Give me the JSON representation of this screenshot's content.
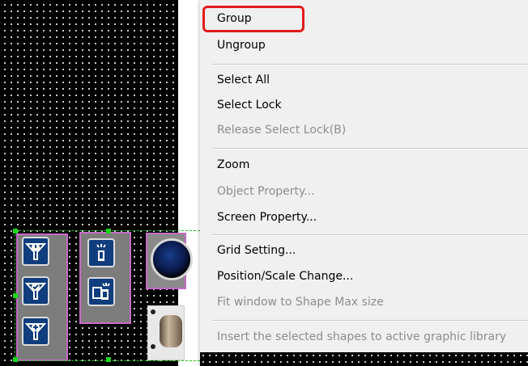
{
  "context_menu": {
    "items": [
      {
        "label": "Group",
        "enabled": true,
        "highlighted": true
      },
      {
        "label": "Ungroup",
        "enabled": true
      },
      {
        "label": "Select All",
        "enabled": true
      },
      {
        "label": "Select Lock",
        "enabled": true
      },
      {
        "label": "Release Select Lock(B)",
        "enabled": false
      },
      {
        "label": "Zoom",
        "enabled": true
      },
      {
        "label": "Object Property...",
        "enabled": false
      },
      {
        "label": "Screen Property...",
        "enabled": true
      },
      {
        "label": "Grid Setting...",
        "enabled": true
      },
      {
        "label": "Position/Scale Change...",
        "enabled": true
      },
      {
        "label": "Fit window to Shape Max size",
        "enabled": false
      },
      {
        "label": "Insert the selected shapes to active graphic library",
        "enabled": false
      }
    ]
  },
  "canvas": {
    "icons": [
      "filter-alert-icon",
      "filter-check-icon",
      "filter-add-icon",
      "lamp-top-icon",
      "device-transfer-icon",
      "round-knob",
      "pilot-lamp"
    ]
  },
  "colors": {
    "highlight_box": "#e21b1b",
    "selection": "#19c419",
    "icon_panel_border": "#c86bc8",
    "icon_bg": "#0f3d7d"
  }
}
